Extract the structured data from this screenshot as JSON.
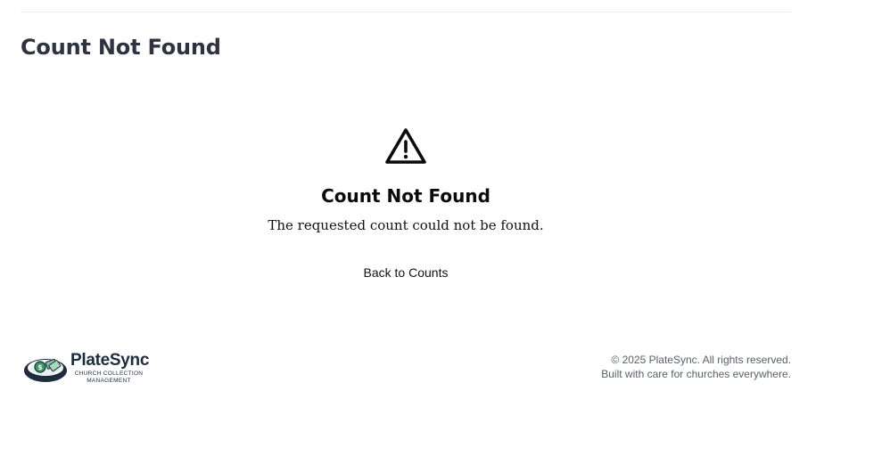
{
  "header": {
    "page_title": "Count Not Found"
  },
  "empty_state": {
    "icon": "warning-triangle-icon",
    "title": "Count Not Found",
    "message": "The requested count could not be found.",
    "back_link": "Back to Counts"
  },
  "footer": {
    "logo": {
      "name": "PlateSync",
      "tagline_line1": "CHURCH COLLECTION",
      "tagline_line2": "MANAGEMENT"
    },
    "copyright": "© 2025 PlateSync. All rights reserved.",
    "tagline": "Built with care for churches everywhere."
  }
}
